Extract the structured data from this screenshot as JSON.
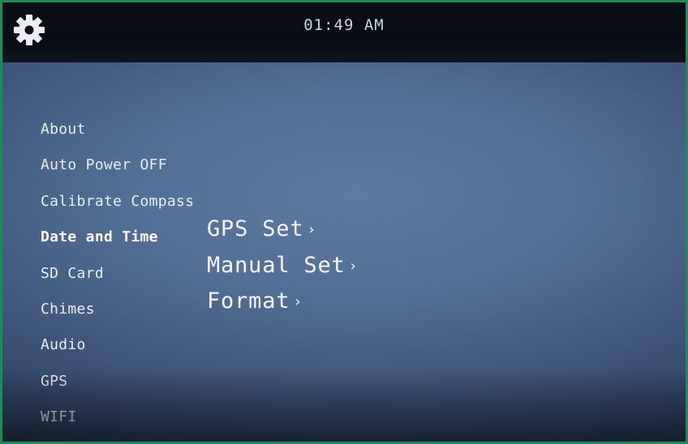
{
  "status_bar": {
    "icon": "gear-icon",
    "time": "01:49 AM"
  },
  "menu": {
    "items": [
      {
        "label": "About"
      },
      {
        "label": "Auto Power OFF"
      },
      {
        "label": "Calibrate Compass"
      },
      {
        "label": "Date and Time",
        "selected": true
      },
      {
        "label": "SD Card"
      },
      {
        "label": "Chimes"
      },
      {
        "label": "Audio"
      },
      {
        "label": "GPS"
      },
      {
        "label": "WIFI"
      }
    ]
  },
  "submenu": {
    "items": [
      {
        "label": "GPS Set",
        "chevron": "›"
      },
      {
        "label": "Manual Set",
        "chevron": "›"
      },
      {
        "label": "Format",
        "chevron": "›"
      }
    ]
  },
  "colors": {
    "frame_border": "#1f8a5a",
    "screen_bg": "#536f95",
    "text": "#e7eef8"
  }
}
